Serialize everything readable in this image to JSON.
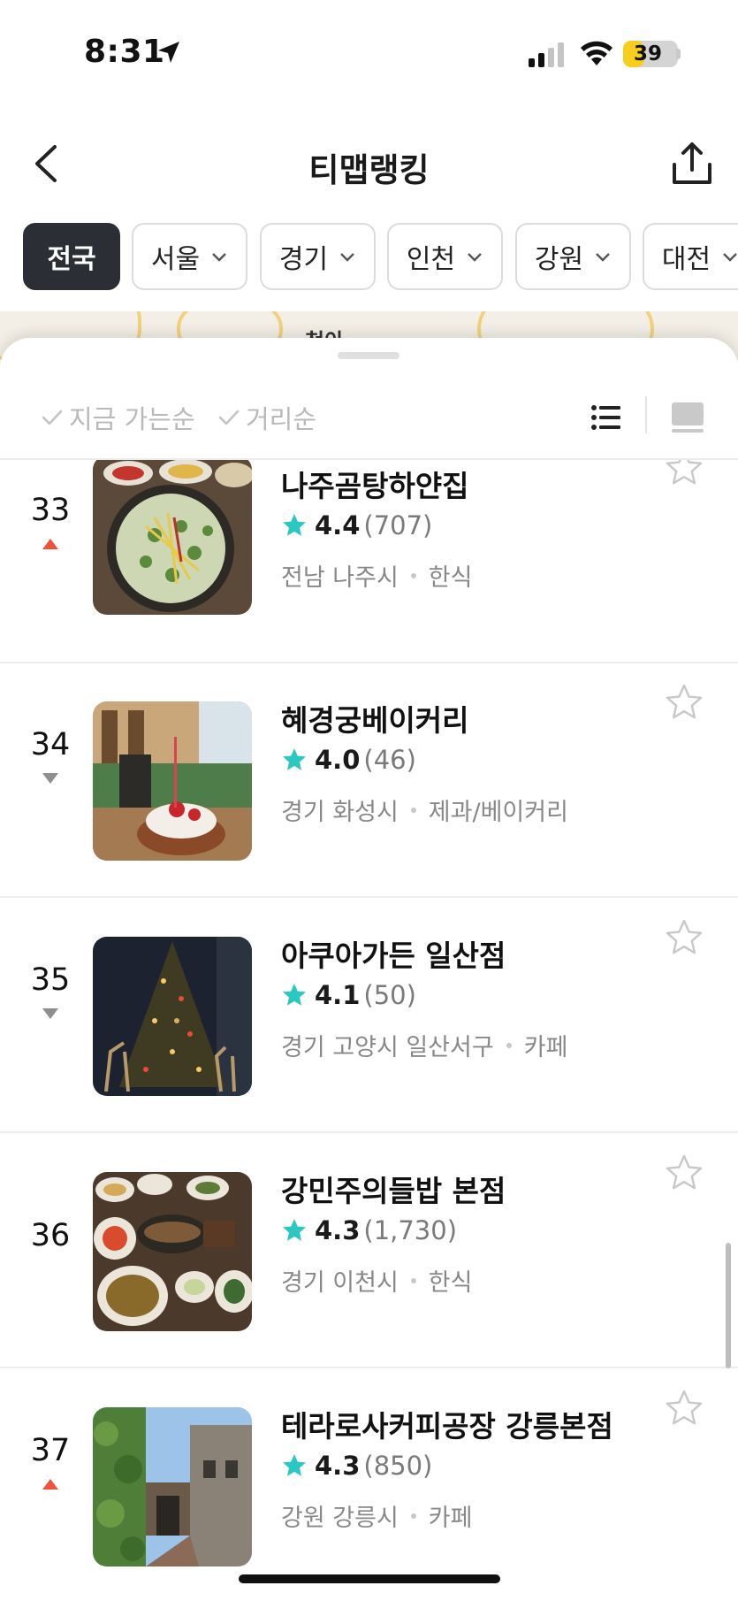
{
  "status_bar": {
    "time": "8:31",
    "battery": "39",
    "battery_level": 0.39
  },
  "header": {
    "title": "티맵랭킹"
  },
  "regions": [
    {
      "label": "전국",
      "active": true,
      "dropdown": false
    },
    {
      "label": "서울",
      "active": false,
      "dropdown": true
    },
    {
      "label": "경기",
      "active": false,
      "dropdown": true
    },
    {
      "label": "인천",
      "active": false,
      "dropdown": true
    },
    {
      "label": "강원",
      "active": false,
      "dropdown": true
    },
    {
      "label": "대전",
      "active": false,
      "dropdown": true
    }
  ],
  "map": {
    "label": "청아"
  },
  "sort": {
    "option1": "지금 가는순",
    "option2": "거리순"
  },
  "colors": {
    "star": "#2bc7c2",
    "rank_up": "#f0533a",
    "rank_down": "#8f8f8f",
    "active_chip": "#2b2f35",
    "battery": "#f7ce1d"
  },
  "places": [
    {
      "rank": "33",
      "trend": "up",
      "name": "나주곰탕하얀집",
      "rating": "4.4",
      "reviews": "(707)",
      "region": "전남 나주시",
      "category": "한식",
      "photo": "gomtang-bowl"
    },
    {
      "rank": "34",
      "trend": "down",
      "name": "혜경궁베이커리",
      "rating": "4.0",
      "reviews": "(46)",
      "region": "경기 화성시",
      "category": "제과/베이커리",
      "photo": "bakery-terrace-pastry"
    },
    {
      "rank": "35",
      "trend": "down",
      "name": "아쿠아가든 일산점",
      "rating": "4.1",
      "reviews": "(50)",
      "region": "경기 고양시 일산서구",
      "category": "카페",
      "photo": "christmas-tree"
    },
    {
      "rank": "36",
      "trend": "none",
      "name": "강민주의들밥 본점",
      "rating": "4.3",
      "reviews": "(1,730)",
      "region": "경기 이천시",
      "category": "한식",
      "photo": "korean-banchan-table"
    },
    {
      "rank": "37",
      "trend": "up",
      "name": "테라로사커피공장 강릉본점",
      "rating": "4.3",
      "reviews": "(850)",
      "region": "강원 강릉시",
      "category": "카페",
      "photo": "ivy-brick-alley"
    }
  ]
}
